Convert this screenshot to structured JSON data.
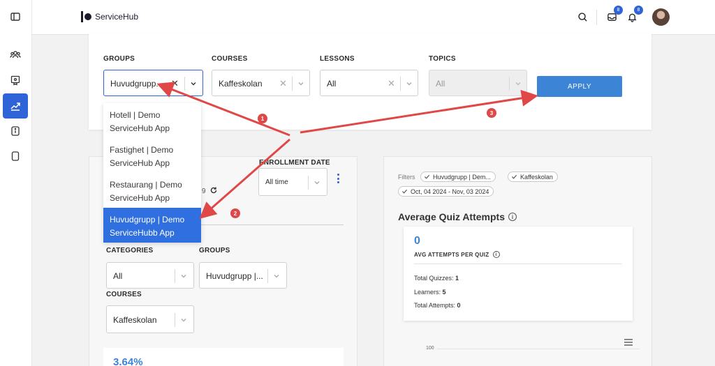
{
  "app": {
    "name": "ServiceHub"
  },
  "topbar": {
    "inbox_count": "8",
    "notif_count": "8"
  },
  "filters": {
    "groups": {
      "label": "GROUPS",
      "value": "Huvudgrupp..."
    },
    "courses": {
      "label": "COURSES",
      "value": "Kaffeskolan"
    },
    "lessons": {
      "label": "LESSONS",
      "value": "All"
    },
    "topics": {
      "label": "TOPICS",
      "value": "All"
    },
    "apply_label": "APPLY"
  },
  "groups_dropdown": {
    "options": [
      {
        "line1": "Hotell | Demo",
        "line2": "ServiceHub App"
      },
      {
        "line1": "Fastighet | Demo",
        "line2": "ServiceHub App"
      },
      {
        "line1": "Restaurang | Demo",
        "line2": "ServiceHub App"
      },
      {
        "line1": "Huvudgrupp | Demo",
        "line2": "ServiceHubb App"
      }
    ]
  },
  "left_card": {
    "enrollment_label": "ENROLLMENT DATE",
    "enrollment_value": "All time",
    "partial_digit": "9",
    "categories_label": "CATEGORIES",
    "categories_value": "All",
    "groups_label": "GROUPS",
    "groups_value": "Huvudgrupp |...",
    "courses_label": "COURSES",
    "courses_value": "Kaffeskolan",
    "stat_value": "3.64%"
  },
  "right_card": {
    "filters_label": "Filters",
    "chips": [
      "Huvudgrupp | Dem...",
      "Kaffeskolan",
      "Oct, 04 2024 - Nov, 03 2024"
    ],
    "title": "Average Quiz Attempts",
    "metric_value": "0",
    "metric_label": "AVG ATTEMPTS PER QUIZ",
    "rows": [
      {
        "label": "Total Quizzes:",
        "value": "1"
      },
      {
        "label": "Learners:",
        "value": "5"
      },
      {
        "label": "Total Attempts:",
        "value": "0"
      }
    ],
    "chart_tick": "100"
  },
  "annotations": [
    "1",
    "2",
    "3"
  ],
  "colors": {
    "accent": "#2f63d8",
    "apply": "#3b84d6",
    "annotation": "#e04848"
  }
}
